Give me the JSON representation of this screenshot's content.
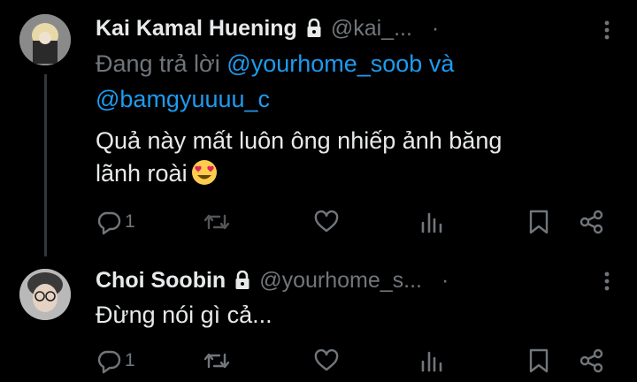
{
  "tweets": [
    {
      "name": "Kai Kamal Huening",
      "handle": "@kai_...",
      "separator": "·",
      "reply_prefix": "Đang trả lời",
      "mention_1": "@yourhome_soob",
      "reply_and": "và",
      "mention_2": "@bamgyuuuu_c",
      "text_line_1": "Quả này mất luôn ông nhiếp ảnh băng",
      "text_line_2": "lãnh roài",
      "reply_count": "1"
    },
    {
      "name": "Choi Soobin",
      "handle": "@yourhome_s...",
      "separator": "·",
      "text_line_1": "Đừng nói gì cả...",
      "reply_count": "1"
    }
  ],
  "icons": {
    "lock": "lock-icon",
    "more": "more-vertical-icon",
    "reply": "reply-icon",
    "retweet": "retweet-icon",
    "like": "heart-icon",
    "views": "views-icon",
    "bookmark": "bookmark-icon",
    "share": "share-icon",
    "emoji": "heart-eyes-emoji"
  },
  "colors": {
    "background": "#000000",
    "primary_text": "#e7e9ea",
    "secondary_text": "#71767b",
    "link": "#1d9bf0",
    "thread_line": "#333639"
  }
}
